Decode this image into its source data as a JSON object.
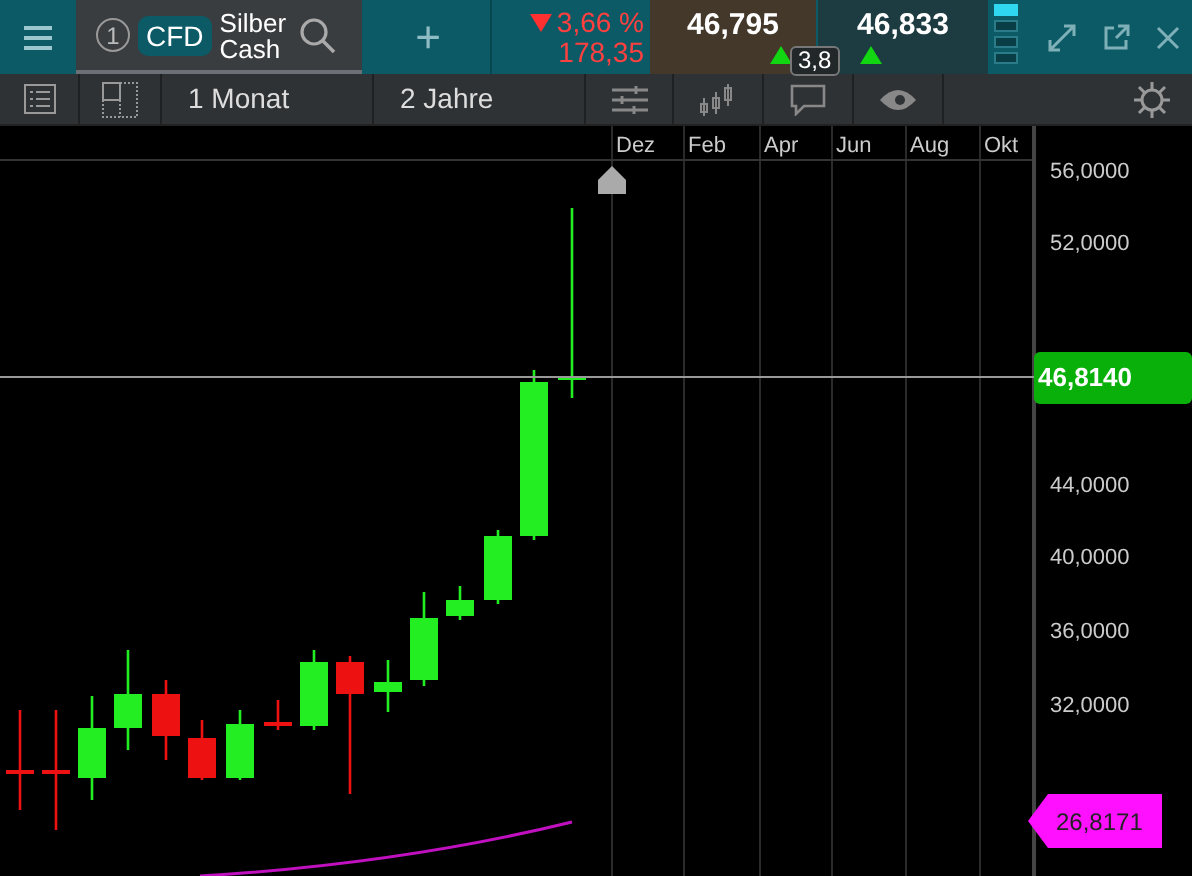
{
  "instrument_tab": {
    "number": "1",
    "badge": "CFD",
    "name_line_1": "Silber",
    "name_line_2": "Cash"
  },
  "add_tab": "+",
  "change": {
    "falling": true,
    "percent": "3,66 %",
    "points": "178,35"
  },
  "bid": {
    "price": "46,795",
    "rising": true
  },
  "ask": {
    "price": "46,833",
    "rising": true
  },
  "spread": "3,8",
  "toolbar": {
    "periods": [
      {
        "label": "1 Monat"
      },
      {
        "label": "2 Jahre"
      }
    ]
  },
  "chart": {
    "months": [
      "Dez",
      "Feb",
      "Apr",
      "Jun",
      "Aug",
      "Okt"
    ],
    "price_axis": [
      "56,0000",
      "52,0000",
      "44,0000",
      "40,0000",
      "36,0000",
      "32,0000"
    ],
    "current_price": "46,8140",
    "average_price": "26,8171"
  }
}
